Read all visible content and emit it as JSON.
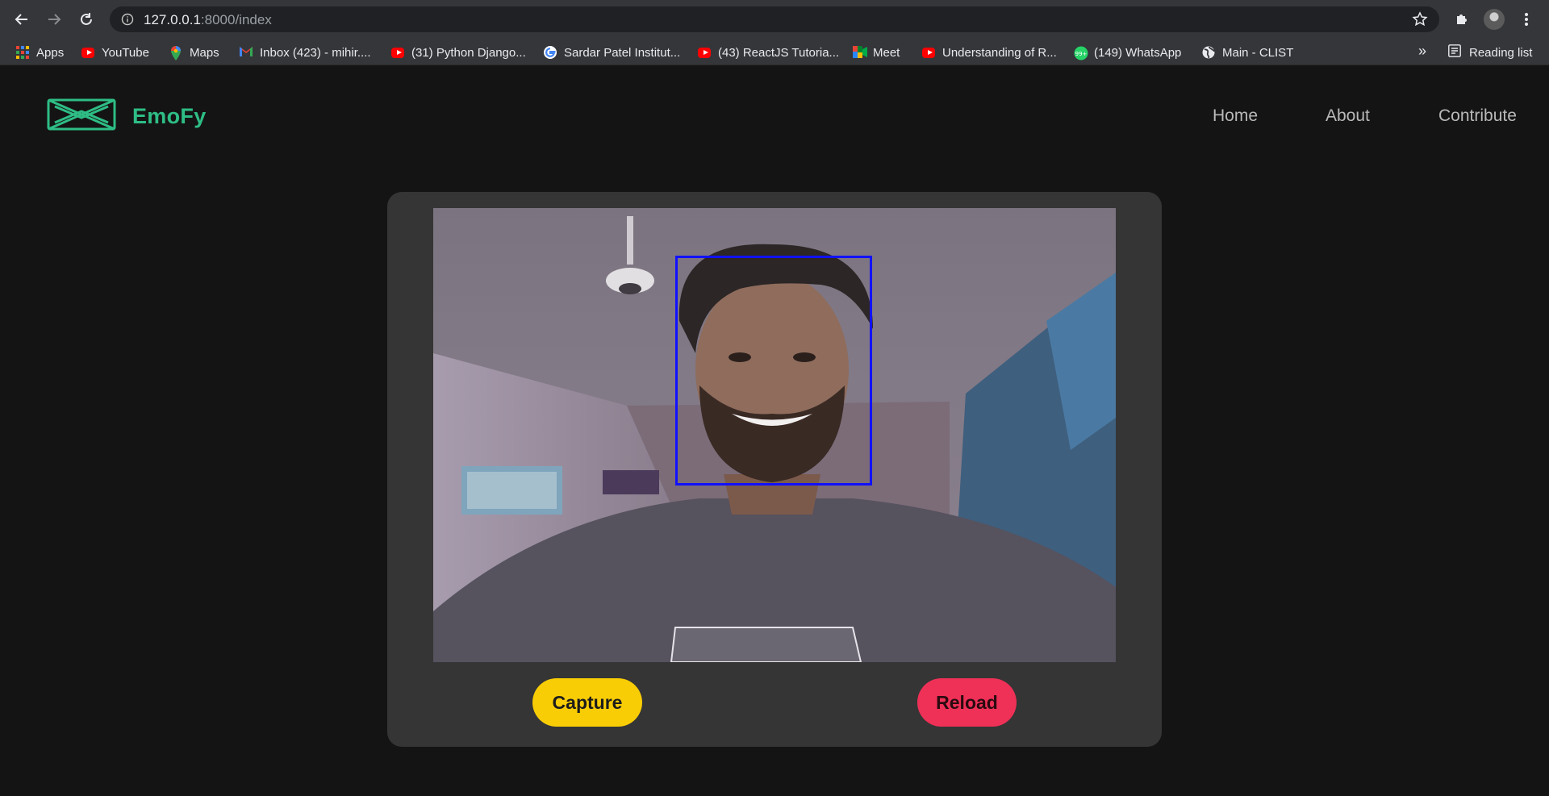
{
  "browser": {
    "url_host": "127.0.0.1",
    "url_path": ":8000/index",
    "bookmarks": [
      {
        "label": "Apps",
        "icon": "apps-grid-icon"
      },
      {
        "label": "YouTube",
        "icon": "youtube-icon"
      },
      {
        "label": "Maps",
        "icon": "maps-pin-icon"
      },
      {
        "label": "Inbox (423) - mihir....",
        "icon": "gmail-icon"
      },
      {
        "label": "(31) Python Django...",
        "icon": "youtube-icon"
      },
      {
        "label": "Sardar Patel Institut...",
        "icon": "google-icon"
      },
      {
        "label": "(43) ReactJS Tutoria...",
        "icon": "youtube-icon"
      },
      {
        "label": "Meet",
        "icon": "meet-icon"
      },
      {
        "label": "Understanding of R...",
        "icon": "youtube-icon"
      },
      {
        "label": "(149) WhatsApp",
        "icon": "whatsapp-icon"
      },
      {
        "label": "Main - CLIST",
        "icon": "globe-icon"
      }
    ],
    "more_label": "»",
    "reading_list_label": "Reading list"
  },
  "site": {
    "brand": "EmoFy",
    "nav": {
      "home": "Home",
      "about": "About",
      "contribute": "Contribute"
    }
  },
  "capture_panel": {
    "capture_label": "Capture",
    "reload_label": "Reload"
  },
  "colors": {
    "brand": "#2ebd85",
    "capture": "#f9cd05",
    "reload": "#ef3057",
    "face_box": "#1111ff"
  }
}
